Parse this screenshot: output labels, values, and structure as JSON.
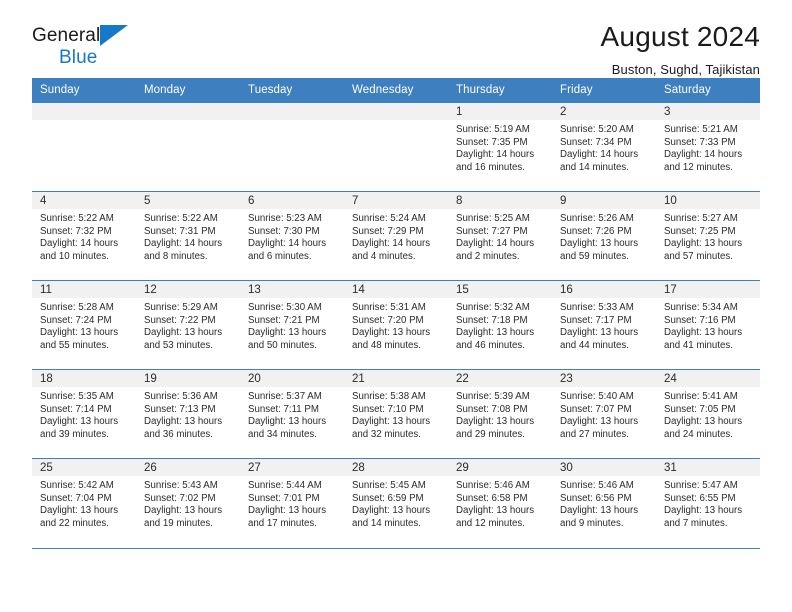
{
  "brand": {
    "word1": "General",
    "word2": "Blue",
    "accent_color": "#1878c8"
  },
  "header": {
    "title": "August 2024",
    "location": "Buston, Sughd, Tajikistan"
  },
  "calendar": {
    "header_color": "#3d7fbf",
    "daynum_bg": "#f1f1f1",
    "weekdays": [
      "Sunday",
      "Monday",
      "Tuesday",
      "Wednesday",
      "Thursday",
      "Friday",
      "Saturday"
    ],
    "weeks": [
      [
        {
          "day": "",
          "empty": true
        },
        {
          "day": "",
          "empty": true
        },
        {
          "day": "",
          "empty": true
        },
        {
          "day": "",
          "empty": true
        },
        {
          "day": "1",
          "sunrise": "Sunrise: 5:19 AM",
          "sunset": "Sunset: 7:35 PM",
          "daylight": "Daylight: 14 hours and 16 minutes."
        },
        {
          "day": "2",
          "sunrise": "Sunrise: 5:20 AM",
          "sunset": "Sunset: 7:34 PM",
          "daylight": "Daylight: 14 hours and 14 minutes."
        },
        {
          "day": "3",
          "sunrise": "Sunrise: 5:21 AM",
          "sunset": "Sunset: 7:33 PM",
          "daylight": "Daylight: 14 hours and 12 minutes."
        }
      ],
      [
        {
          "day": "4",
          "sunrise": "Sunrise: 5:22 AM",
          "sunset": "Sunset: 7:32 PM",
          "daylight": "Daylight: 14 hours and 10 minutes."
        },
        {
          "day": "5",
          "sunrise": "Sunrise: 5:22 AM",
          "sunset": "Sunset: 7:31 PM",
          "daylight": "Daylight: 14 hours and 8 minutes."
        },
        {
          "day": "6",
          "sunrise": "Sunrise: 5:23 AM",
          "sunset": "Sunset: 7:30 PM",
          "daylight": "Daylight: 14 hours and 6 minutes."
        },
        {
          "day": "7",
          "sunrise": "Sunrise: 5:24 AM",
          "sunset": "Sunset: 7:29 PM",
          "daylight": "Daylight: 14 hours and 4 minutes."
        },
        {
          "day": "8",
          "sunrise": "Sunrise: 5:25 AM",
          "sunset": "Sunset: 7:27 PM",
          "daylight": "Daylight: 14 hours and 2 minutes."
        },
        {
          "day": "9",
          "sunrise": "Sunrise: 5:26 AM",
          "sunset": "Sunset: 7:26 PM",
          "daylight": "Daylight: 13 hours and 59 minutes."
        },
        {
          "day": "10",
          "sunrise": "Sunrise: 5:27 AM",
          "sunset": "Sunset: 7:25 PM",
          "daylight": "Daylight: 13 hours and 57 minutes."
        }
      ],
      [
        {
          "day": "11",
          "sunrise": "Sunrise: 5:28 AM",
          "sunset": "Sunset: 7:24 PM",
          "daylight": "Daylight: 13 hours and 55 minutes."
        },
        {
          "day": "12",
          "sunrise": "Sunrise: 5:29 AM",
          "sunset": "Sunset: 7:22 PM",
          "daylight": "Daylight: 13 hours and 53 minutes."
        },
        {
          "day": "13",
          "sunrise": "Sunrise: 5:30 AM",
          "sunset": "Sunset: 7:21 PM",
          "daylight": "Daylight: 13 hours and 50 minutes."
        },
        {
          "day": "14",
          "sunrise": "Sunrise: 5:31 AM",
          "sunset": "Sunset: 7:20 PM",
          "daylight": "Daylight: 13 hours and 48 minutes."
        },
        {
          "day": "15",
          "sunrise": "Sunrise: 5:32 AM",
          "sunset": "Sunset: 7:18 PM",
          "daylight": "Daylight: 13 hours and 46 minutes."
        },
        {
          "day": "16",
          "sunrise": "Sunrise: 5:33 AM",
          "sunset": "Sunset: 7:17 PM",
          "daylight": "Daylight: 13 hours and 44 minutes."
        },
        {
          "day": "17",
          "sunrise": "Sunrise: 5:34 AM",
          "sunset": "Sunset: 7:16 PM",
          "daylight": "Daylight: 13 hours and 41 minutes."
        }
      ],
      [
        {
          "day": "18",
          "sunrise": "Sunrise: 5:35 AM",
          "sunset": "Sunset: 7:14 PM",
          "daylight": "Daylight: 13 hours and 39 minutes."
        },
        {
          "day": "19",
          "sunrise": "Sunrise: 5:36 AM",
          "sunset": "Sunset: 7:13 PM",
          "daylight": "Daylight: 13 hours and 36 minutes."
        },
        {
          "day": "20",
          "sunrise": "Sunrise: 5:37 AM",
          "sunset": "Sunset: 7:11 PM",
          "daylight": "Daylight: 13 hours and 34 minutes."
        },
        {
          "day": "21",
          "sunrise": "Sunrise: 5:38 AM",
          "sunset": "Sunset: 7:10 PM",
          "daylight": "Daylight: 13 hours and 32 minutes."
        },
        {
          "day": "22",
          "sunrise": "Sunrise: 5:39 AM",
          "sunset": "Sunset: 7:08 PM",
          "daylight": "Daylight: 13 hours and 29 minutes."
        },
        {
          "day": "23",
          "sunrise": "Sunrise: 5:40 AM",
          "sunset": "Sunset: 7:07 PM",
          "daylight": "Daylight: 13 hours and 27 minutes."
        },
        {
          "day": "24",
          "sunrise": "Sunrise: 5:41 AM",
          "sunset": "Sunset: 7:05 PM",
          "daylight": "Daylight: 13 hours and 24 minutes."
        }
      ],
      [
        {
          "day": "25",
          "sunrise": "Sunrise: 5:42 AM",
          "sunset": "Sunset: 7:04 PM",
          "daylight": "Daylight: 13 hours and 22 minutes."
        },
        {
          "day": "26",
          "sunrise": "Sunrise: 5:43 AM",
          "sunset": "Sunset: 7:02 PM",
          "daylight": "Daylight: 13 hours and 19 minutes."
        },
        {
          "day": "27",
          "sunrise": "Sunrise: 5:44 AM",
          "sunset": "Sunset: 7:01 PM",
          "daylight": "Daylight: 13 hours and 17 minutes."
        },
        {
          "day": "28",
          "sunrise": "Sunrise: 5:45 AM",
          "sunset": "Sunset: 6:59 PM",
          "daylight": "Daylight: 13 hours and 14 minutes."
        },
        {
          "day": "29",
          "sunrise": "Sunrise: 5:46 AM",
          "sunset": "Sunset: 6:58 PM",
          "daylight": "Daylight: 13 hours and 12 minutes."
        },
        {
          "day": "30",
          "sunrise": "Sunrise: 5:46 AM",
          "sunset": "Sunset: 6:56 PM",
          "daylight": "Daylight: 13 hours and 9 minutes."
        },
        {
          "day": "31",
          "sunrise": "Sunrise: 5:47 AM",
          "sunset": "Sunset: 6:55 PM",
          "daylight": "Daylight: 13 hours and 7 minutes."
        }
      ]
    ]
  }
}
